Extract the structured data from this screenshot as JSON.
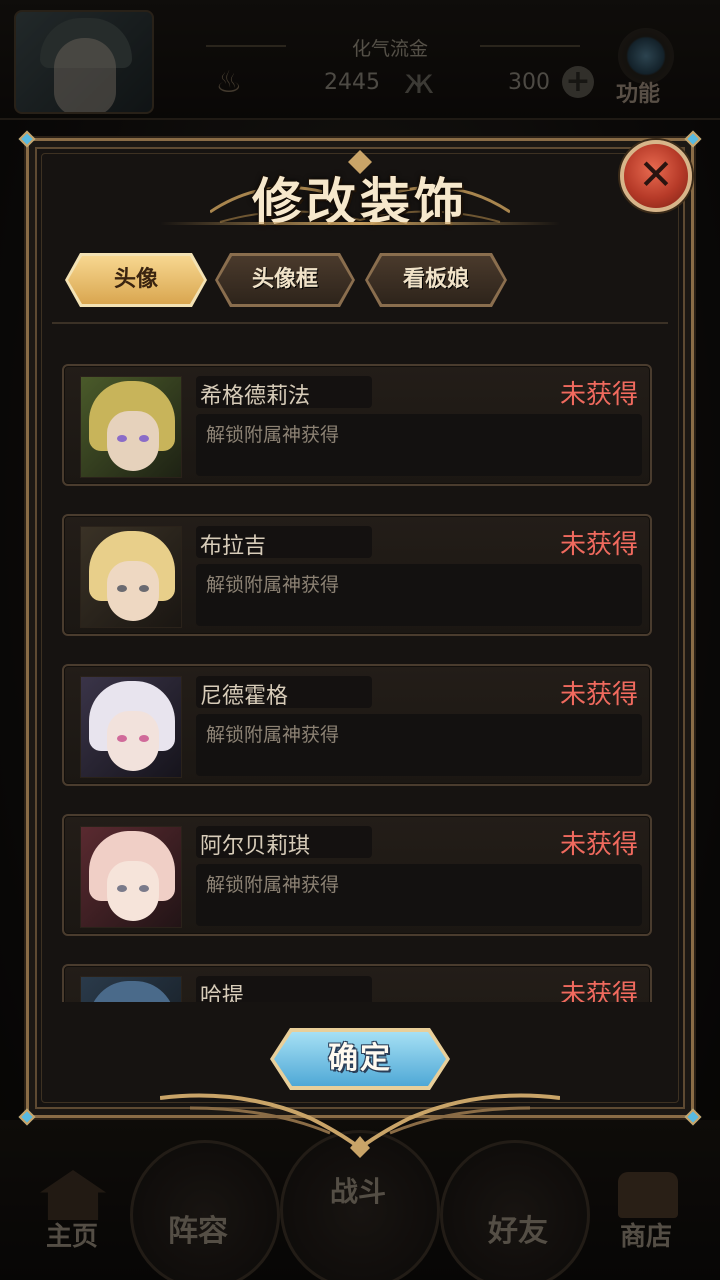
{
  "hud": {
    "player_name": "化气流金",
    "soul_icon": "flame-icon",
    "soul_value": "2445",
    "butterfly_icon": "butterfly-icon",
    "gem_value": "300",
    "plus_icon": "plus-icon",
    "function_label": "功能"
  },
  "bottom_nav": {
    "home": "主页",
    "team": "阵容",
    "battle": "战斗",
    "friends": "好友",
    "shop": "商店"
  },
  "modal": {
    "title": "修改装饰",
    "close_icon": "close-icon",
    "tabs": [
      {
        "label": "头像",
        "active": true
      },
      {
        "label": "头像框",
        "active": false
      },
      {
        "label": "看板娘",
        "active": false
      }
    ],
    "items": [
      {
        "name": "希格德莉法",
        "status": "未获得",
        "desc": "解锁附属神获得"
      },
      {
        "name": "布拉吉",
        "status": "未获得",
        "desc": "解锁附属神获得"
      },
      {
        "name": "尼德霍格",
        "status": "未获得",
        "desc": "解锁附属神获得"
      },
      {
        "name": "阿尔贝莉琪",
        "status": "未获得",
        "desc": "解锁附属神获得"
      },
      {
        "name": "哈提",
        "status": "未获得",
        "desc": ""
      }
    ],
    "confirm_label": "确定"
  },
  "colors": {
    "status_red": "#f06a5e",
    "tab_active": "#d9a650",
    "confirm_blue": "#4fa8d6",
    "frame_gold": "#8a6c46"
  }
}
